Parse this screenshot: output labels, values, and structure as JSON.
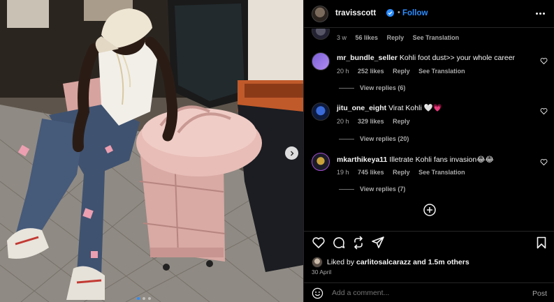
{
  "post": {
    "username": "travisscott",
    "separator": "•",
    "follow_label": "Follow"
  },
  "comments": [
    {
      "username": "",
      "text": "",
      "age": "3 w",
      "likes": "56 likes",
      "reply_label": "Reply",
      "translate_label": "See Translation"
    },
    {
      "username": "mr_bundle_seller",
      "text": "Kohli foot dust>> your whole career",
      "age": "20 h",
      "likes": "252 likes",
      "reply_label": "Reply",
      "translate_label": "See Translation",
      "replies_label": "View replies (6)"
    },
    {
      "username": "jitu_one_eight",
      "text": "Virat Kohli 🤍💗",
      "age": "20 h",
      "likes": "329 likes",
      "reply_label": "Reply",
      "replies_label": "View replies (20)"
    },
    {
      "username": "mkarthikeya11",
      "text": "Illetrate Kohli fans invasion😂😂",
      "age": "19 h",
      "likes": "745 likes",
      "reply_label": "Reply",
      "translate_label": "See Translation",
      "replies_label": "View replies (7)"
    }
  ],
  "liked_by": {
    "prefix": "Liked by",
    "user": "carlitosalcarazz",
    "suffix": "and 1.5m others"
  },
  "date": "30 April",
  "add_comment": {
    "placeholder": "Add a comment...",
    "post_label": "Post"
  },
  "colors": {
    "accent": "#2b8cff",
    "background": "#000000",
    "muted_text": "#a8a8a8"
  },
  "icons": [
    "verified-badge-icon",
    "more-icon",
    "heart-icon",
    "comment-icon",
    "share-icon",
    "send-icon",
    "save-icon",
    "emoji-icon",
    "plus-circle-icon",
    "chevron-right-icon"
  ],
  "carousel": {
    "slide_count": 3,
    "active_slide": 1
  }
}
